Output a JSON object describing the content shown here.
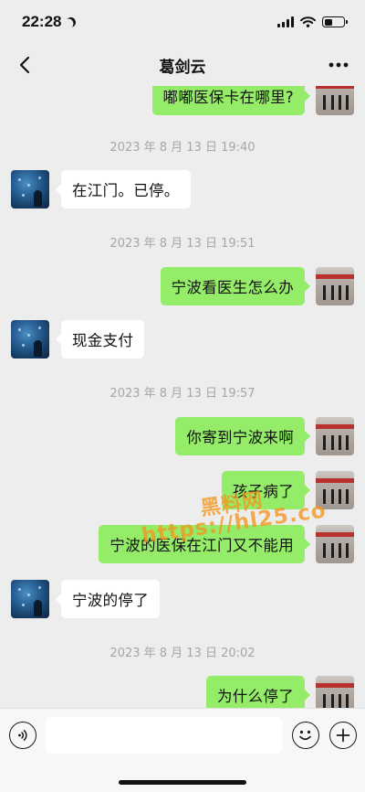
{
  "status": {
    "time": "22:28"
  },
  "nav": {
    "title": "葛剑云",
    "back_icon": "chevron-left-icon",
    "more_icon": "more-icon"
  },
  "messages": [
    {
      "type": "out",
      "text": "嘟嘟医保卡在哪里?"
    },
    {
      "type": "time",
      "text": "2023 年 8 月 13 日 19:40"
    },
    {
      "type": "in",
      "text": "在江门。已停。"
    },
    {
      "type": "time",
      "text": "2023 年 8 月 13 日 19:51"
    },
    {
      "type": "out",
      "text": "宁波看医生怎么办"
    },
    {
      "type": "in",
      "text": "现金支付"
    },
    {
      "type": "time",
      "text": "2023 年 8 月 13 日 19:57"
    },
    {
      "type": "out",
      "text": "你寄到宁波来啊"
    },
    {
      "type": "out",
      "text": "孩子病了"
    },
    {
      "type": "out",
      "text": "宁波的医保在江门又不能用"
    },
    {
      "type": "in",
      "text": "宁波的停了"
    },
    {
      "type": "time",
      "text": "2023 年 8 月 13 日 20:02"
    },
    {
      "type": "out",
      "text": "为什么停了"
    }
  ],
  "watermark": {
    "line1": "黑料网",
    "line2": "https://hl25.co"
  },
  "input": {
    "placeholder": "",
    "voice_icon": "voice-icon",
    "emoji_icon": "emoji-icon",
    "plus_icon": "plus-icon"
  },
  "colors": {
    "outgoing_bubble": "#95ec69",
    "incoming_bubble": "#ffffff",
    "background": "#ededed",
    "watermark": "#f2961e"
  }
}
